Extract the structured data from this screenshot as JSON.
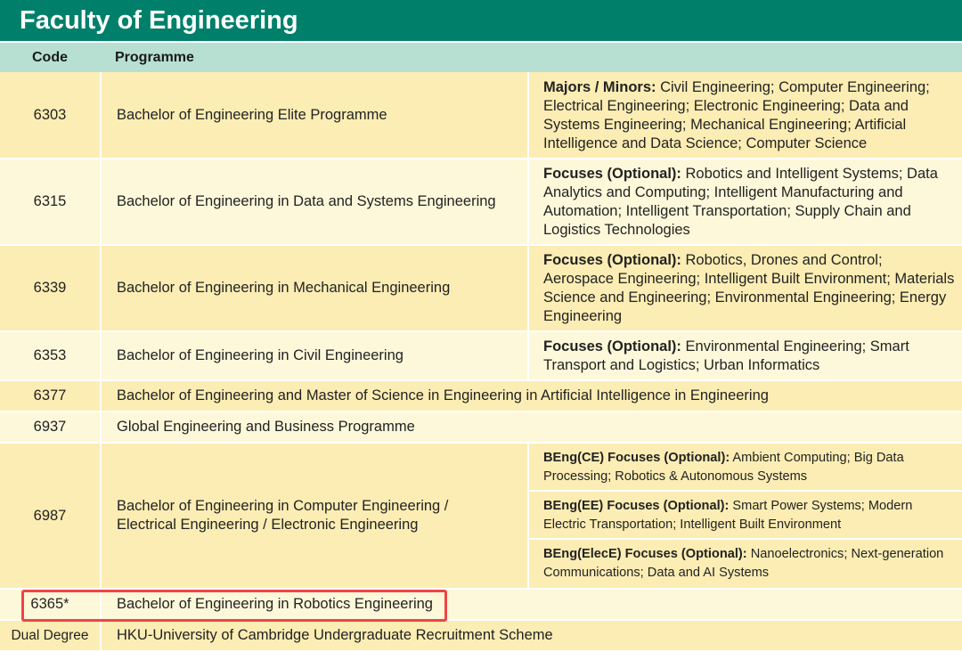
{
  "banner": {
    "title": "Faculty of Engineering"
  },
  "header": {
    "code": "Code",
    "programme": "Programme"
  },
  "rows": [
    {
      "code": "6303",
      "name": "Bachelor of Engineering Elite Programme",
      "note_label": "Majors / Minors:",
      "note_text": " Civil Engineering; Computer Engineering; Electrical Engineering; Electronic Engineering; Data and Systems Engineering; Mechanical Engineering; Artificial Intelligence and Data Science; Computer Science"
    },
    {
      "code": "6315",
      "name": "Bachelor of Engineering in Data and Systems Engineering",
      "note_label": "Focuses (Optional):",
      "note_text": " Robotics and Intelligent Systems; Data Analytics and Computing; Intelligent Manufacturing and Automation; Intelligent Transportation; Supply Chain and Logistics Technologies"
    },
    {
      "code": "6339",
      "name": "Bachelor of Engineering in Mechanical Engineering",
      "note_label": "Focuses (Optional):",
      "note_text": " Robotics, Drones and Control; Aerospace Engineering; Intelligent Built Environment; Materials Science and Engineering; Environmental Engineering; Energy Engineering"
    },
    {
      "code": "6353",
      "name": "Bachelor of Engineering in Civil Engineering",
      "note_label": "Focuses (Optional):",
      "note_text": " Environmental Engineering; Smart Transport and Logistics; Urban Informatics"
    },
    {
      "code": "6377",
      "name": "Bachelor of Engineering and Master of Science in Engineering in Artificial Intelligence in Engineering"
    },
    {
      "code": "6937",
      "name": "Global Engineering and Business Programme"
    },
    {
      "code": "6987",
      "name": "Bachelor of Engineering in Computer Engineering / Electrical Engineering / Electronic Engineering",
      "subnotes": [
        {
          "label": "BEng(CE) Focuses (Optional):",
          "text": " Ambient Computing; Big Data Processing; Robotics & Autonomous Systems"
        },
        {
          "label": "BEng(EE) Focuses (Optional):",
          "text": " Smart Power Systems; Modern Electric Transportation; Intelligent Built Environment"
        },
        {
          "label": "BEng(ElecE) Focuses (Optional):",
          "text": " Nanoelectronics; Next-generation Communications; Data and AI Systems"
        }
      ]
    },
    {
      "code": "6365*",
      "name": "Bachelor of Engineering in Robotics Engineering"
    },
    {
      "code": "Dual Degree",
      "name": "HKU-University of Cambridge Undergraduate Recruitment Scheme"
    }
  ],
  "colors": {
    "banner": "#00806a",
    "header": "#b7e0d3",
    "row_dark": "#fcedb4",
    "row_light": "#fef8da",
    "highlight": "#ee4545"
  }
}
